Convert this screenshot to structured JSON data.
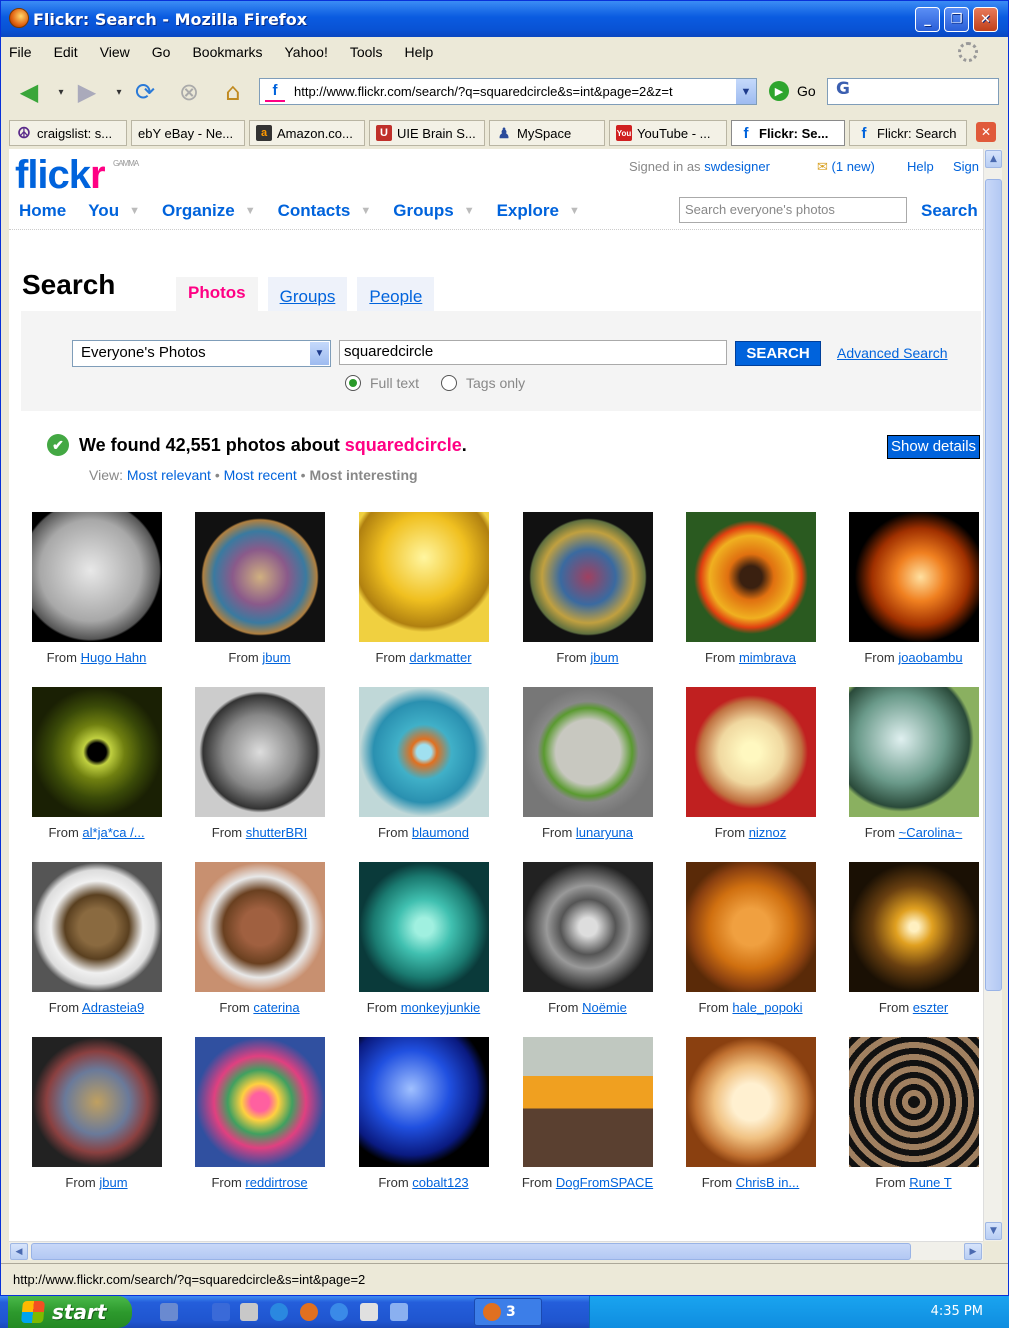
{
  "window": {
    "title": "Flickr: Search - Mozilla Firefox"
  },
  "menu": [
    "File",
    "Edit",
    "View",
    "Go",
    "Bookmarks",
    "Yahoo!",
    "Tools",
    "Help"
  ],
  "url": "http://www.flickr.com/search/?q=squaredcircle&s=int&page=2&z=t",
  "go_label": "Go",
  "bookmarks": [
    {
      "label": "craigslist: s...",
      "icon": "peace-icon",
      "color": "#5a2a8a"
    },
    {
      "label": "ebY eBay - Ne...",
      "icon": "ebay-icon",
      "color": "#e53238"
    },
    {
      "label": "Amazon.co...",
      "icon": "amazon-icon",
      "color": "#333333"
    },
    {
      "label": "UIE Brain S...",
      "icon": "uie-icon",
      "color": "#c0302a"
    },
    {
      "label": "MySpace",
      "icon": "myspace-icon",
      "color": "#2a4a9a"
    },
    {
      "label": "YouTube - ...",
      "icon": "youtube-icon",
      "color": "#d02020"
    },
    {
      "label": "Flickr: Se...",
      "icon": "flickr-icon",
      "color": "#0063dc"
    },
    {
      "label": "Flickr: Search",
      "icon": "flickr-icon",
      "color": "#0063dc"
    }
  ],
  "flickr": {
    "signed_in_prefix": "Signed in as",
    "username": "swdesigner",
    "mail": "(1 new)",
    "help": "Help",
    "signout": "Sign",
    "gamma": "GAMMA",
    "nav": [
      "Home",
      "You",
      "Organize",
      "Contacts",
      "Groups",
      "Explore"
    ],
    "search_placeholder": "Search everyone's photos",
    "search_button": "Search"
  },
  "search": {
    "heading": "Search",
    "tabs": [
      "Photos",
      "Groups",
      "People"
    ],
    "scope": "Everyone's Photos",
    "query": "squaredcircle",
    "button": "SEARCH",
    "advanced": "Advanced Search",
    "radio_full": "Full text",
    "radio_tags": "Tags only",
    "found_prefix": "We found 42,551 photos about",
    "found_query": "squaredcircle",
    "found_suffix": ".",
    "show_details": "Show details",
    "view_label": "View:",
    "view_relevant": "Most relevant",
    "view_recent": "Most recent",
    "view_interesting": "Most interesting",
    "sep": "•"
  },
  "photos": [
    {
      "from": "From",
      "user": "Hugo Hahn",
      "style": "moon"
    },
    {
      "from": "From",
      "user": "jbum",
      "style": "mosaic"
    },
    {
      "from": "From",
      "user": "darkmatter",
      "style": "yellow"
    },
    {
      "from": "From",
      "user": "jbum",
      "style": "mosaic2"
    },
    {
      "from": "From",
      "user": "mimbrava",
      "style": "flower"
    },
    {
      "from": "From",
      "user": "joaobambu",
      "style": "fire"
    },
    {
      "from": "From",
      "user": "al*ja*ca /...",
      "style": "tunnel"
    },
    {
      "from": "From",
      "user": "shutterBRI",
      "style": "bw"
    },
    {
      "from": "From",
      "user": "blaumond",
      "style": "teal"
    },
    {
      "from": "From",
      "user": "lunaryuna",
      "style": "wreath"
    },
    {
      "from": "From",
      "user": "niznoz",
      "style": "pancake"
    },
    {
      "from": "From",
      "user": "~Carolina~",
      "style": "sphere"
    },
    {
      "from": "From",
      "user": "Adrasteia9",
      "style": "cat"
    },
    {
      "from": "From",
      "user": "caterina",
      "style": "bucket"
    },
    {
      "from": "From",
      "user": "monkeyjunkie",
      "style": "aqua"
    },
    {
      "from": "From",
      "user": "Noëmie",
      "style": "cats"
    },
    {
      "from": "From",
      "user": "hale_popoki",
      "style": "orangecat"
    },
    {
      "from": "From",
      "user": "eszter",
      "style": "starburst"
    },
    {
      "from": "From",
      "user": "jbum",
      "style": "mosaic3"
    },
    {
      "from": "From",
      "user": "reddirtrose",
      "style": "kaleido"
    },
    {
      "from": "From",
      "user": "cobalt123",
      "style": "blueball"
    },
    {
      "from": "From",
      "user": "DogFromSPACE",
      "style": "gates"
    },
    {
      "from": "From",
      "user": "ChrisB in...",
      "style": "latte"
    },
    {
      "from": "From",
      "user": "Rune T",
      "style": "spiral"
    }
  ],
  "status": "http://www.flickr.com/search/?q=squaredcircle&s=int&page=2",
  "taskbar": {
    "start": "start",
    "firefox_count": "3",
    "clock": "4:35 PM"
  }
}
